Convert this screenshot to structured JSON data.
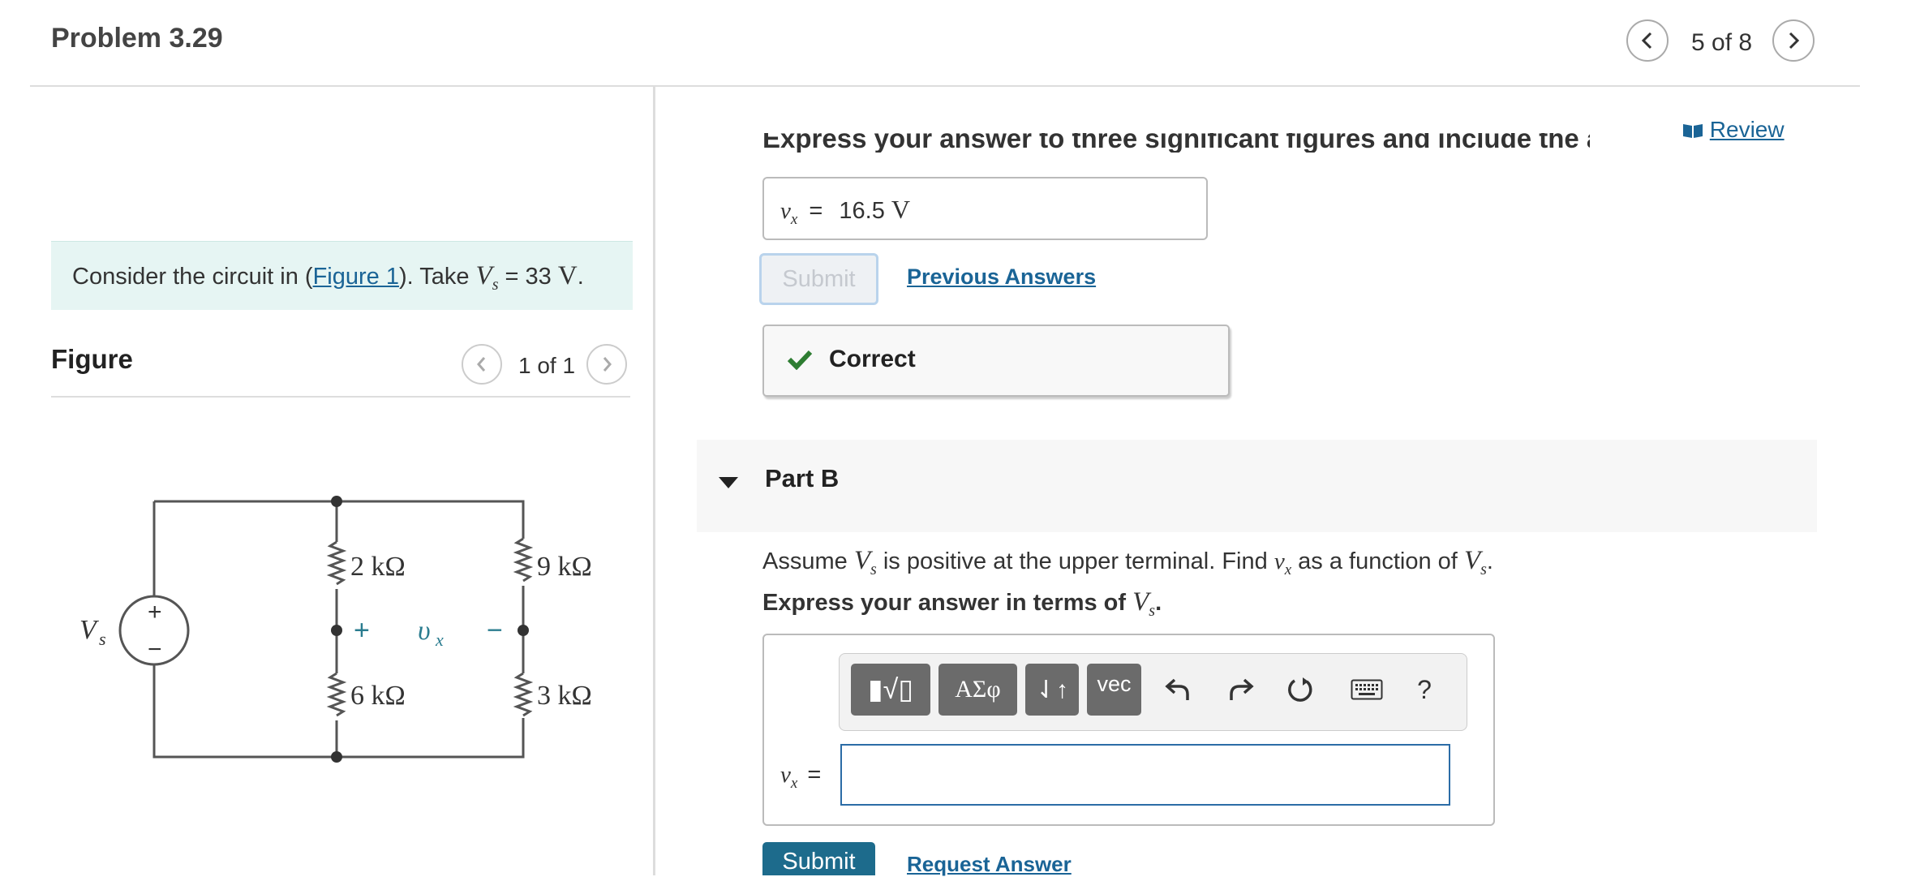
{
  "header": {
    "title": "Problem 3.29",
    "pager": "5 of 8"
  },
  "problem": {
    "intro_prefix": "Consider the circuit in (",
    "figure_link": "Figure 1",
    "intro_mid": "). Take ",
    "vs_var": "V",
    "vs_sub": "s",
    "vs_eq": " = 33 ",
    "vs_unit": "V",
    "intro_end": "."
  },
  "figure": {
    "heading": "Figure",
    "pager": "1 of 1",
    "labels": {
      "source": "V",
      "source_sub": "s",
      "r1": "2 kΩ",
      "r2": "9 kΩ",
      "r3": "6 kΩ",
      "r4": "3 kΩ",
      "vx": "υ",
      "vx_sub": "x",
      "plus": "+",
      "minus": "−",
      "src_plus": "+",
      "src_minus": "−"
    }
  },
  "review": {
    "label": "Review"
  },
  "part_a": {
    "instruction_cut": "Express your answer to three significant figures and include the appropriate units.",
    "answer_var": "v",
    "answer_sub": "x",
    "answer_eq": "=",
    "answer_value": "16.5",
    "answer_unit": "V",
    "submit_label": "Submit",
    "previous_answers": "Previous Answers",
    "feedback": "Correct"
  },
  "part_b": {
    "title": "Part B",
    "question_1": "Assume ",
    "question_var": "V",
    "question_var_sub": "s",
    "question_2": " is positive at the upper terminal. Find ",
    "question_vx": "v",
    "question_vx_sub": "x",
    "question_3": " as a function of ",
    "question_end": ".",
    "express": "Express your answer in terms of ",
    "express_var": "V",
    "express_sub": "s",
    "express_end": ".",
    "toolbar": {
      "templates": "▮√▯",
      "greek": "ΑΣφ",
      "updown": "⇃↑",
      "vec": "vec",
      "undo_icon": "undo-icon",
      "redo_icon": "redo-icon",
      "reset_icon": "reset-icon",
      "keyboard_icon": "keyboard-icon",
      "help": "?"
    },
    "answer_var": "v",
    "answer_sub": "x",
    "answer_eq": "=",
    "answer_value": "",
    "submit_label": "Submit",
    "request_answer": "Request Answer"
  },
  "colors": {
    "accent": "#1a6496",
    "intro_bg": "#e6f5f3",
    "correct_green": "#2e7d32",
    "submit_bg": "#1d6b8c"
  }
}
